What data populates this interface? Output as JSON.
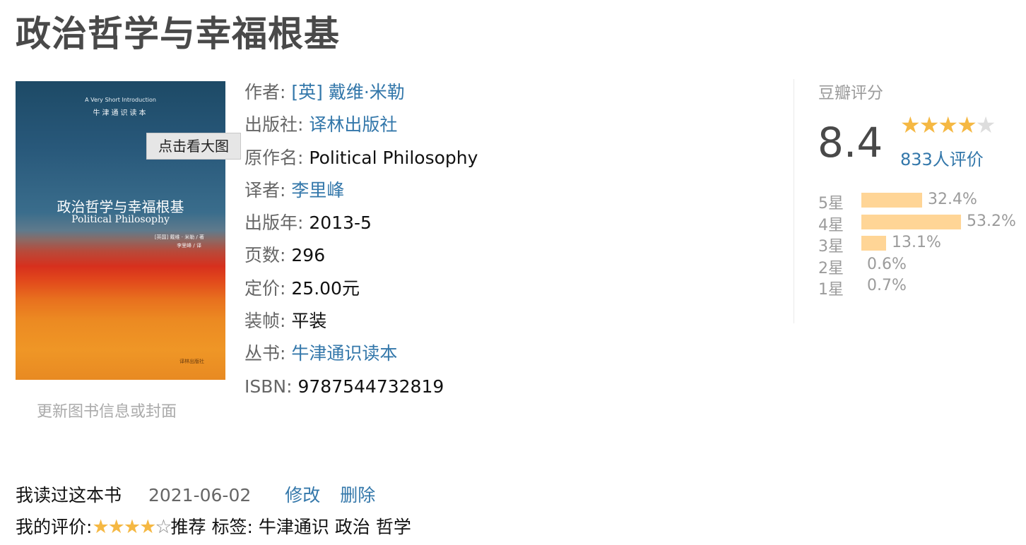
{
  "book_title": "政治哲学与幸福根基",
  "cover": {
    "series_en": "A Very Short Introduction",
    "series_cn": "牛津通识读本",
    "title_cn": "政治哲学与幸福根基",
    "title_en": "Political Philosophy",
    "author_line": "[英国] 戴维 · 米勒 / 著",
    "translator_line": "李里峰 / 译",
    "publisher_mark": "译林出版社"
  },
  "zoom_tip": "点击看大图",
  "update_link": "更新图书信息或封面",
  "info": {
    "author": {
      "label": "作者:",
      "value": "[英] 戴维·米勒"
    },
    "publisher": {
      "label": "出版社:",
      "value": "译林出版社"
    },
    "original_title": {
      "label": "原作名:",
      "value": "Political Philosophy"
    },
    "translator": {
      "label": "译者:",
      "value": "李里峰"
    },
    "pub_year": {
      "label": "出版年:",
      "value": "2013-5"
    },
    "pages": {
      "label": "页数:",
      "value": "296"
    },
    "price": {
      "label": "定价:",
      "value": "25.00元"
    },
    "binding": {
      "label": "装帧:",
      "value": "平装"
    },
    "series": {
      "label": "丛书:",
      "value": "牛津通识读本"
    },
    "isbn": {
      "label": "ISBN:",
      "value": "9787544732819"
    }
  },
  "rating": {
    "title": "豆瓣评分",
    "score": "8.4",
    "stars_filled": 4,
    "stars_total": 5,
    "votes": "833人评价",
    "distribution": [
      {
        "label": "5星",
        "percent_text": "32.4%",
        "percent": 32.4
      },
      {
        "label": "4星",
        "percent_text": "53.2%",
        "percent": 53.2
      },
      {
        "label": "3星",
        "percent_text": "13.1%",
        "percent": 13.1
      },
      {
        "label": "2星",
        "percent_text": "0.6%",
        "percent": 0.6
      },
      {
        "label": "1星",
        "percent_text": "0.7%",
        "percent": 0.7
      }
    ]
  },
  "my_status": {
    "read_text": "我读过这本书",
    "date": "2021-06-02",
    "edit": "修改",
    "delete": "删除",
    "my_rating_label": "我的评价:",
    "my_stars_filled": 4,
    "my_stars_total": 5,
    "recommend_text": "推荐",
    "tags_label": "标签:",
    "tags": [
      "牛津通识",
      "政治",
      "哲学"
    ]
  },
  "colors": {
    "link": "#3377aa",
    "star": "#f5b843",
    "bar": "#ffd596",
    "title": "#494949"
  }
}
